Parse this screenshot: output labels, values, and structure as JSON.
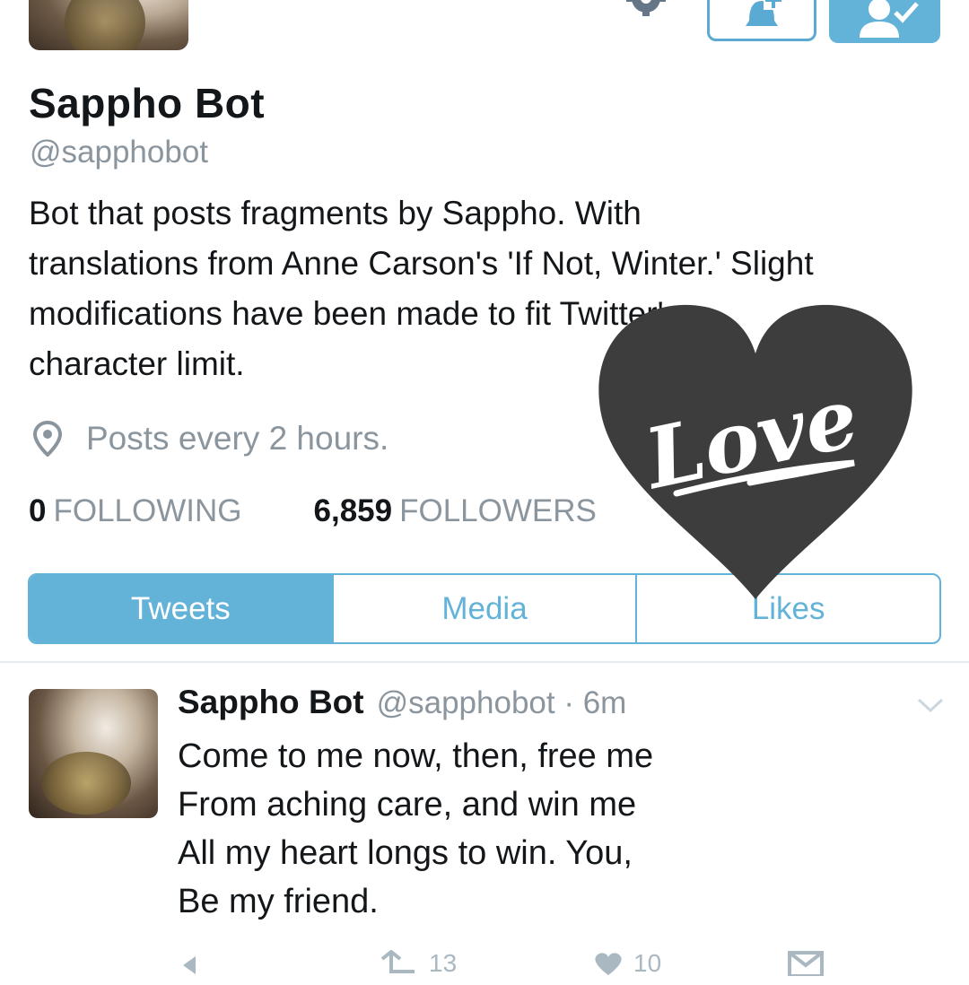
{
  "profile": {
    "name": "Sappho Bot",
    "handle": "@sapphobot",
    "bio_lines": [
      "Bot that posts fragments by Sappho. With",
      "translations from Anne Carson's 'If Not, Winter.' Slight",
      "modifications have been made to fit Twitter's",
      "character limit."
    ],
    "location": "Posts every 2 hours.",
    "following_count": "0",
    "following_label": "FOLLOWING",
    "followers_count": "6,859",
    "followers_label": "FOLLOWERS"
  },
  "tabs": [
    {
      "label": "Tweets",
      "active": true
    },
    {
      "label": "Media",
      "active": false
    },
    {
      "label": "Likes",
      "active": false
    }
  ],
  "tweet": {
    "name": "Sappho Bot",
    "handle_time": "@sapphobot · 6m",
    "lines": [
      "Come to me now, then, free me",
      "From aching care, and win me",
      "All my heart longs to win. You,",
      "Be my friend."
    ],
    "retweets": "13",
    "likes": "10"
  },
  "overlay": {
    "sticker_text": "Love"
  },
  "colors": {
    "accent": "#63b3d8",
    "muted": "#8a959e",
    "sticker": "#3d3d3d"
  },
  "icons": [
    "gear-icon",
    "bell-plus-icon",
    "person-check-icon",
    "location-pin-icon",
    "chevron-down-icon",
    "reply-icon",
    "retweet-icon",
    "heart-icon",
    "message-icon"
  ]
}
